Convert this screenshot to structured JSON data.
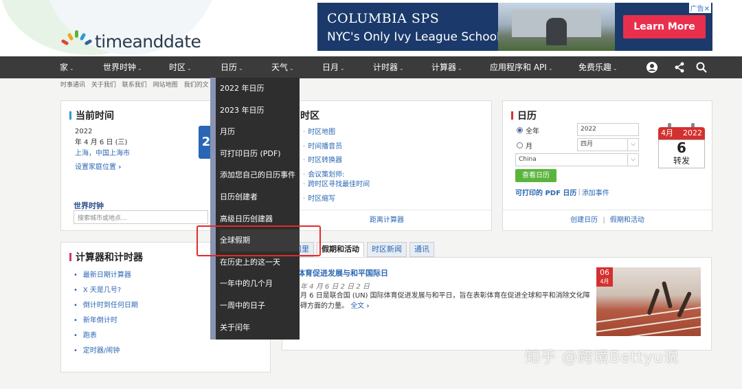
{
  "header": {
    "logo_text": "timeanddate",
    "ad": {
      "brand": "COLUMBIA SPS",
      "tagline": "NYC's Only Ivy League School",
      "cta": "Learn More",
      "ad_label": "广告✕"
    }
  },
  "nav": {
    "items": [
      {
        "label": "家",
        "chev": "⌄"
      },
      {
        "label": "世界时钟",
        "chev": "⌄"
      },
      {
        "label": "时区",
        "chev": "⌄"
      },
      {
        "label": "日历",
        "chev": "⌄"
      },
      {
        "label": "天气",
        "chev": "⌄"
      },
      {
        "label": "日月",
        "chev": "⌄"
      },
      {
        "label": "计时器",
        "chev": "⌄"
      },
      {
        "label": "计算器",
        "chev": "⌄"
      },
      {
        "label": "应用程序和 API",
        "chev": "⌄"
      },
      {
        "label": "免费乐趣",
        "chev": "⌄"
      }
    ],
    "icons": [
      "user-icon",
      "share-icon",
      "search-icon"
    ]
  },
  "breadcrumbs": [
    "时事通讯",
    "关于我们",
    "联系我们",
    "网站地图",
    "我们的文"
  ],
  "current_time": {
    "title": "当前时间",
    "year": "2022",
    "date": "年 4 月 6 日 (三)",
    "location": "上海，中国上海市",
    "set_home": "设置家庭位置",
    "clock_digit": "2",
    "world_clock_label": "世界时钟",
    "search_placeholder": "搜索城市或地点..."
  },
  "timezones": {
    "title": "时区",
    "items": [
      "时区地图",
      "时间播音员",
      "时区转换器",
      "会议策划师:",
      "跨时区寻找最佳时间",
      "时区缩写"
    ],
    "footer": "距离计算器"
  },
  "calendar": {
    "title": "日历",
    "radio_year": "全年",
    "radio_month": "月",
    "year_value": "2022",
    "month_value": "四月",
    "country_value": "China",
    "view_button": "查看日历",
    "printable": "可打印的 PDF 日历",
    "add_event": "添加事件",
    "footer_create": "创建日历",
    "footer_holidays": "假期和活动",
    "icon": {
      "month": "4月",
      "year": "2022",
      "day": "6",
      "weekday": "转发"
    }
  },
  "calculators": {
    "title": "计算器和计时器",
    "items": [
      "最新日期计算器",
      "X 天是几号?",
      "倒计时到任何日期",
      "新年倒计时",
      "跑表",
      "定时器/闹钟"
    ]
  },
  "news": {
    "tabs": [
      "新闻里",
      "假期和活动",
      "时区新闻",
      "通讯"
    ],
    "active_tab": 1,
    "title": "体育促进发展与和平国际日",
    "date": "年 4 月 6 日 2 日 2 日",
    "text": "月 6 日是联合国 (UN) 国际体育促进发展与和平日，旨在表彰体育在促进全球和平和消除文化障碍方面的力量。",
    "more": "全文",
    "badge_day": "06",
    "badge_month": "4月"
  },
  "dropdown": {
    "items": [
      "2022 年日历",
      "2023 年日历",
      "月历",
      "可打印日历 (PDF)",
      "添加您自己的日历事件",
      "日历创建者",
      "高级日历创建器",
      "全球假期",
      "在历史上的这一天",
      "一年中的几个月",
      "一周中的日子",
      "关于闰年"
    ],
    "highlighted_index": 7
  },
  "watermark": "知乎 @跨境Bettyu说"
}
